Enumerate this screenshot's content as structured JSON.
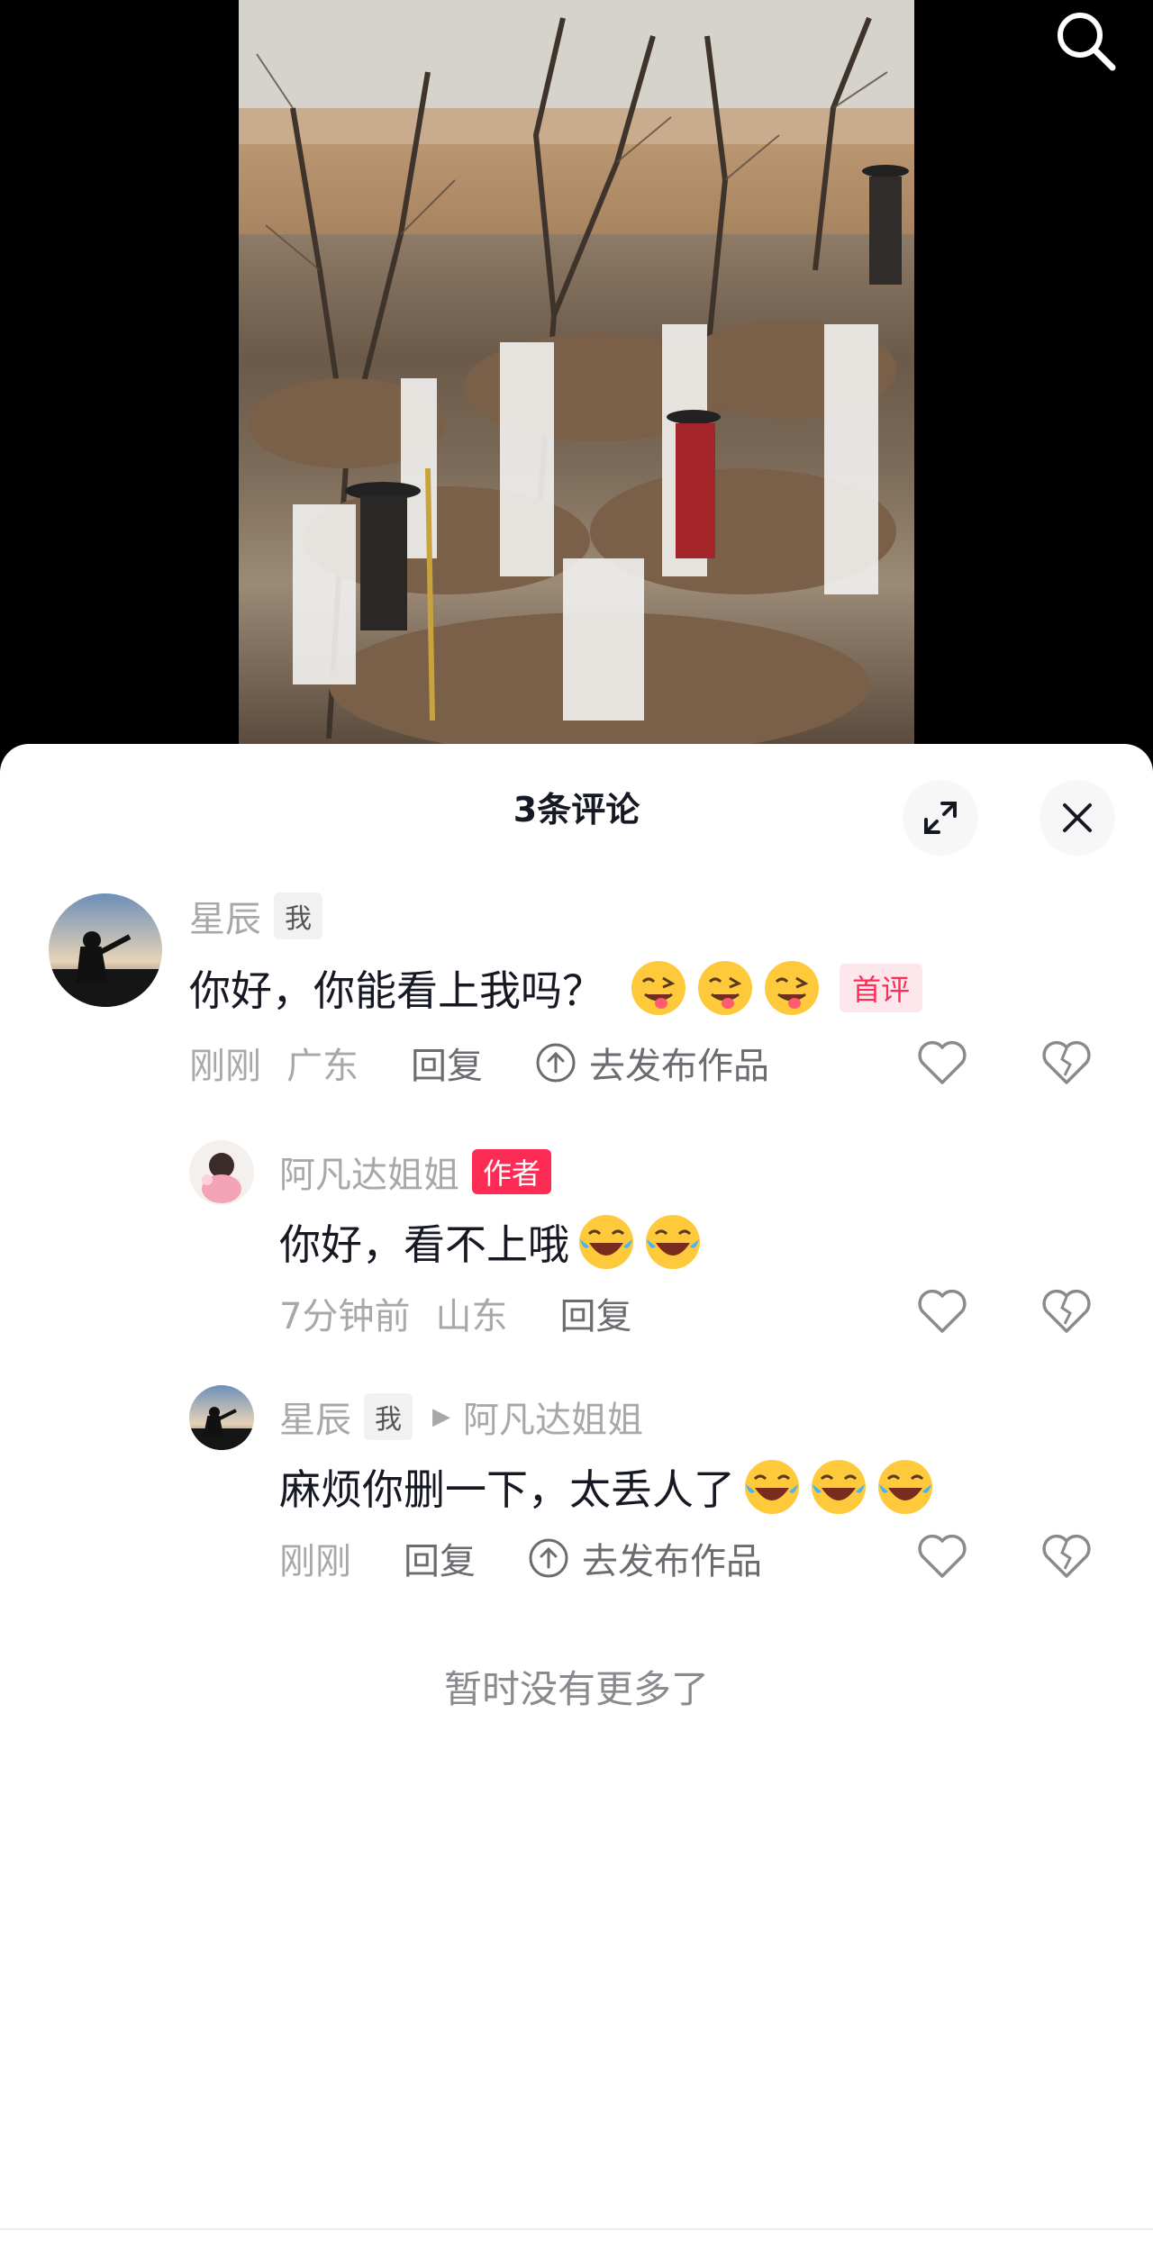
{
  "header": {
    "search_icon": "search-icon"
  },
  "comments_panel": {
    "title": "3条评论",
    "expand_icon": "expand-icon",
    "close_icon": "close-icon",
    "comments": [
      {
        "user": "星辰",
        "me_tag": "我",
        "text": "你好，你能看上我吗？",
        "emoji": "wink-tongue-emoji",
        "first_tag": "首评",
        "time": "刚刚",
        "location": "广东",
        "reply_label": "回复",
        "publish_label": "去发布作品"
      },
      {
        "user": "阿凡达姐姐",
        "author_tag": "作者",
        "text": "你好，看不上哦",
        "emoji": "laugh-cry-emoji",
        "time": "7分钟前",
        "location": "山东",
        "reply_label": "回复"
      },
      {
        "user": "星辰",
        "me_tag": "我",
        "reply_to": "阿凡达姐姐",
        "text": "麻烦你删一下，太丢人了",
        "emoji": "laugh-cry-emoji",
        "time": "刚刚",
        "reply_label": "回复",
        "publish_label": "去发布作品"
      }
    ],
    "no_more": "暂时没有更多了"
  },
  "colors": {
    "accent": "#fe2c55",
    "text": "#161823",
    "muted": "#a8a8ab"
  }
}
